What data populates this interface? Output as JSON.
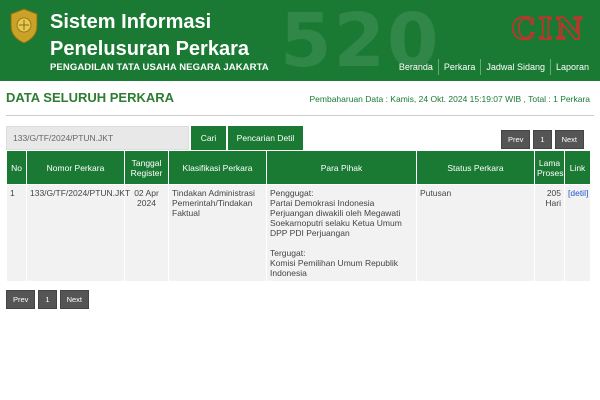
{
  "header": {
    "title": "Sistem Informasi Penelusuran Perkara",
    "subtitle": "PENGADILAN TATA USAHA NEGARA JAKARTA",
    "watermark": "520",
    "brand": "CIN",
    "nav": [
      "Beranda",
      "Perkara",
      "Jadwal Sidang",
      "Laporan"
    ]
  },
  "section": {
    "title": "DATA SELURUH PERKARA",
    "update_info": "Pembaharuan Data : Kamis, 24 Okt. 2024 15:19:07 WIB , Total : 1 Perkara"
  },
  "search": {
    "value": "133/G/TF/2024/PTUN.JKT",
    "cari_label": "Cari",
    "detil_label": "Pencarian Detil"
  },
  "pager": {
    "prev": "Prev",
    "page": "1",
    "next": "Next"
  },
  "table": {
    "headers": {
      "no": "No",
      "nomor": "Nomor Perkara",
      "tanggal": "Tanggal Register",
      "klasifikasi": "Klasifikasi Perkara",
      "para_pihak": "Para Pihak",
      "status": "Status Perkara",
      "lama": "Lama Proses",
      "link": "Link"
    },
    "rows": [
      {
        "no": "1",
        "nomor": "133/G/TF/2024/PTUN.JKT",
        "tanggal": "02 Apr 2024",
        "klasifikasi": "Tindakan Administrasi Pemerintah/Tindakan Faktual",
        "penggugat_label": "Penggugat:",
        "penggugat": "Partai Demokrasi Indonesia Perjuangan diwakili oleh Megawati Soekarnoputri selaku Ketua Umum DPP PDI Perjuangan",
        "tergugat_label": "Tergugat:",
        "tergugat": "Komisi Pemilihan Umum Republik Indonesia",
        "status": "Putusan",
        "lama": "205 Hari",
        "link": "[detil]"
      }
    ]
  },
  "colors": {
    "primary": "#1a7a33",
    "brand_stroke": "#d62b2b",
    "link": "#2255cc"
  }
}
